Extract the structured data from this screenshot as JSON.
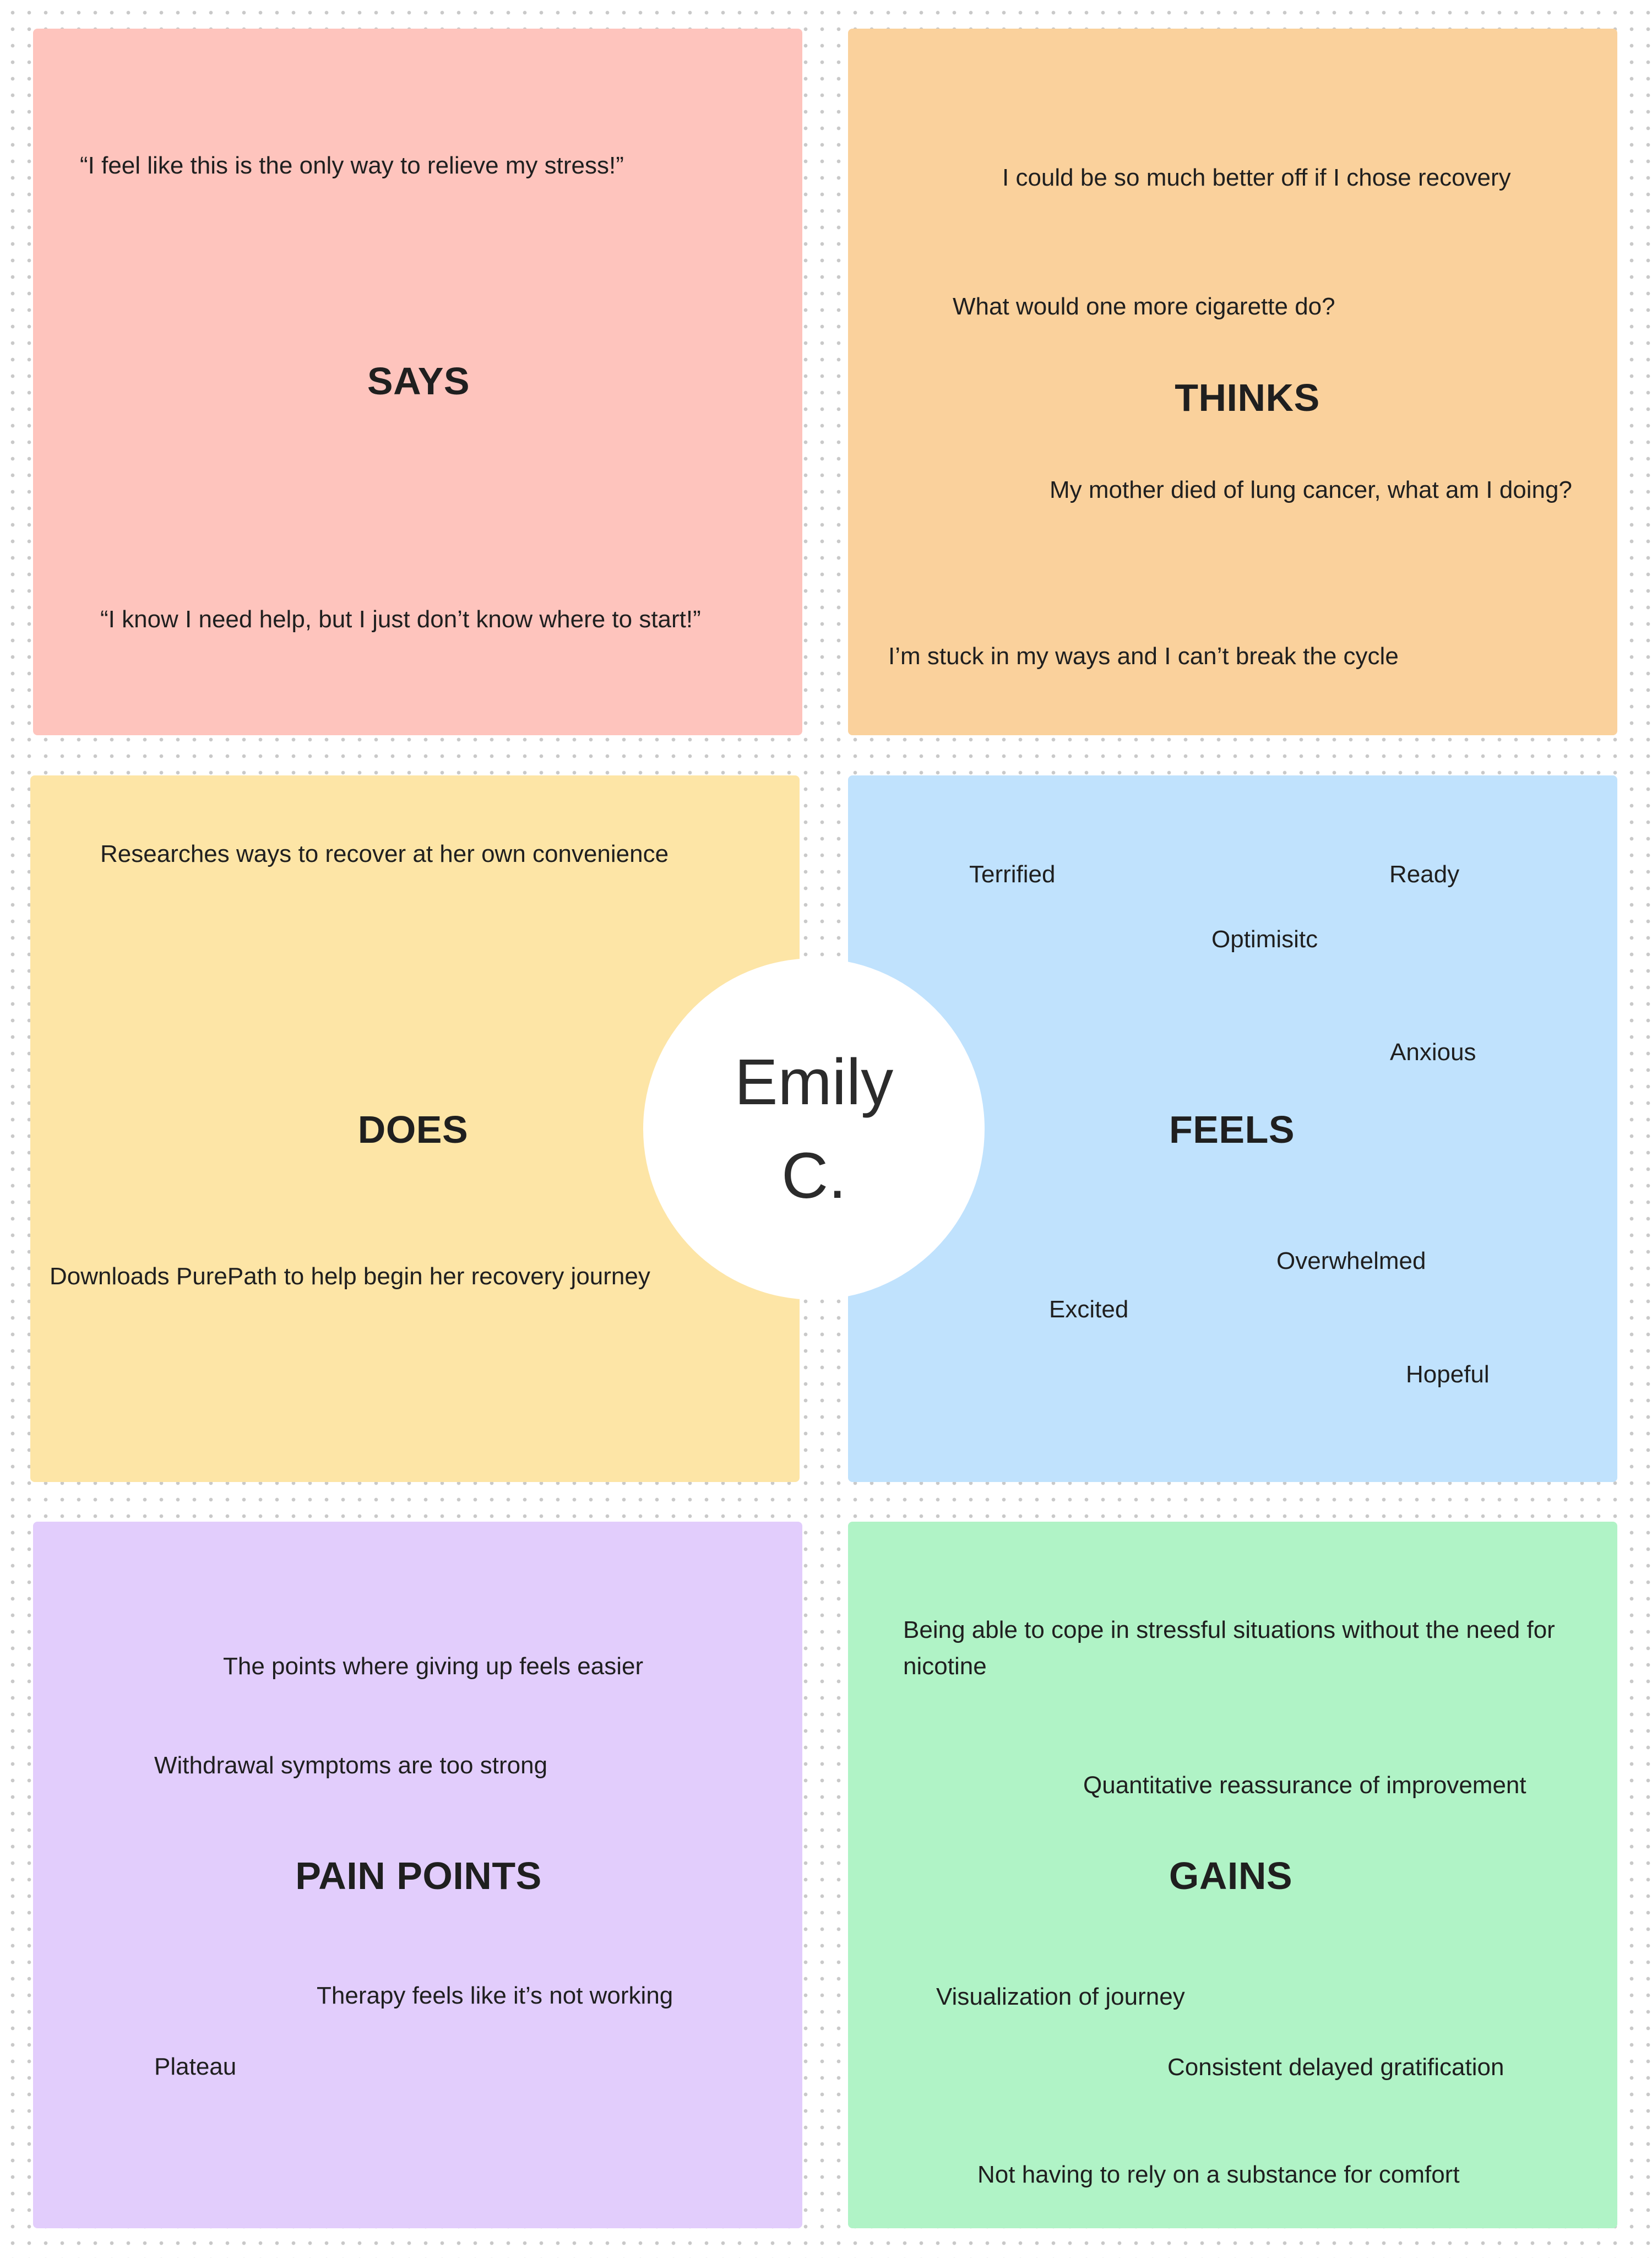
{
  "quadrants": {
    "says": {
      "color": "#fec4bd",
      "title": "SAYS",
      "notes": [
        "“I feel like this is the only way to relieve my stress!”",
        "“I know I need help, but I just don’t know where to start!”"
      ]
    },
    "thinks": {
      "color": "#fad19c",
      "title": "THINKS",
      "notes": [
        "I could be so much better off if I chose recovery",
        "What would one more cigarette do?",
        "My mother died of lung cancer, what am I doing?",
        "I’m stuck in my ways and I can’t break the cycle"
      ]
    },
    "does": {
      "color": "#fde5a6",
      "title": "DOES",
      "notes": [
        "Researches ways to recover at her own convenience",
        "Downloads PurePath to help begin her recovery journey"
      ]
    },
    "feels": {
      "color": "#c0e2fd",
      "title": "FEELS",
      "notes": [
        "Terrified",
        "Ready",
        "Optimisitc",
        "Anxious",
        "Overwhelmed",
        "Excited",
        "Hopeful"
      ]
    },
    "pain_points": {
      "color": "#e2cdfc",
      "title": "PAIN POINTS",
      "notes": [
        "The points where giving up feels easier",
        "Withdrawal symptoms are too strong",
        "Therapy feels like it’s not working",
        "Plateau"
      ]
    },
    "gains": {
      "color": "#b0f3c6",
      "title": "GAINS",
      "notes": [
        "Being able to cope in stressful situations without the need for nicotine",
        "Quantitative reassurance of improvement",
        "Visualization of journey",
        "Consistent delayed gratification",
        "Not having to rely on a substance for comfort"
      ]
    }
  },
  "persona": {
    "name": "Emily C."
  }
}
